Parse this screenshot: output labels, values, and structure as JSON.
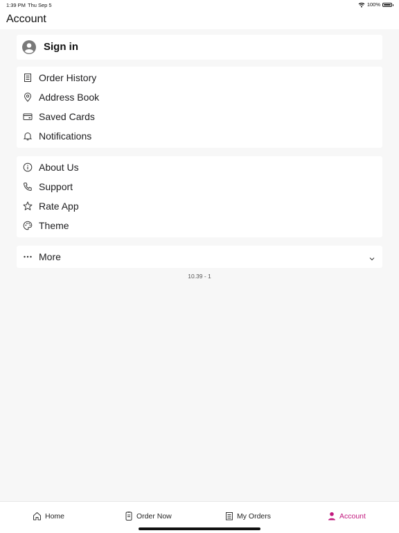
{
  "status_bar": {
    "time": "1:39 PM",
    "date": "Thu Sep 5",
    "battery": "100%"
  },
  "header": {
    "title": "Account"
  },
  "sign_in": {
    "label": "Sign in"
  },
  "group1": [
    {
      "label": "Order History",
      "icon": "receipt-icon"
    },
    {
      "label": "Address Book",
      "icon": "location-pin-icon"
    },
    {
      "label": "Saved Cards",
      "icon": "credit-card-icon"
    },
    {
      "label": "Notifications",
      "icon": "bell-icon"
    }
  ],
  "group2": [
    {
      "label": "About Us",
      "icon": "info-icon"
    },
    {
      "label": "Support",
      "icon": "phone-icon"
    },
    {
      "label": "Rate App",
      "icon": "star-icon"
    },
    {
      "label": "Theme",
      "icon": "palette-icon"
    }
  ],
  "more": {
    "label": "More",
    "icon": "ellipsis-icon"
  },
  "version": "10.39 - 1",
  "tabs": [
    {
      "label": "Home",
      "icon": "home-icon",
      "active": false
    },
    {
      "label": "Order Now",
      "icon": "order-icon",
      "active": false
    },
    {
      "label": "My Orders",
      "icon": "orders-list-icon",
      "active": false
    },
    {
      "label": "Account",
      "icon": "person-icon",
      "active": true
    }
  ],
  "colors": {
    "accent": "#c2187e",
    "background": "#f7f7f7",
    "card": "#ffffff"
  }
}
